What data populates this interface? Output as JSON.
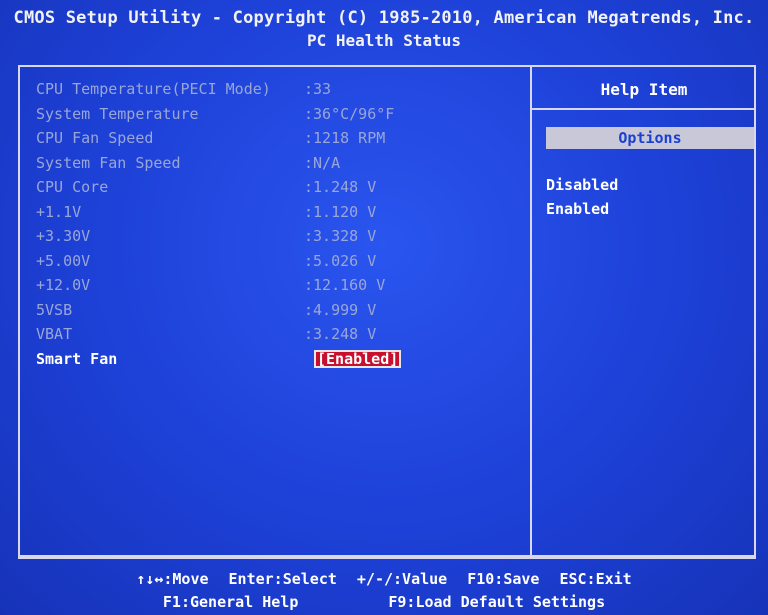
{
  "header": {
    "title": "CMOS Setup Utility - Copyright (C) 1985-2010, American Megatrends, Inc.",
    "subtitle": "PC Health Status"
  },
  "rows": [
    {
      "label": "CPU Temperature(PECI Mode)",
      "value": ":33"
    },
    {
      "label": "System Temperature",
      "value": ":36°C/96°F"
    },
    {
      "label": "CPU Fan Speed",
      "value": ":1218 RPM"
    },
    {
      "label": "System Fan Speed",
      "value": ":N/A"
    },
    {
      "label": "CPU Core",
      "value": ":1.248 V"
    },
    {
      "label": "+1.1V",
      "value": ":1.120 V"
    },
    {
      "label": "+3.30V",
      "value": ":3.328 V"
    },
    {
      "label": "+5.00V",
      "value": ":5.026 V"
    },
    {
      "label": "+12.0V",
      "value": ":12.160 V"
    },
    {
      "label": "5VSB",
      "value": ":4.999 V"
    },
    {
      "label": "VBAT",
      "value": ":3.248 V"
    },
    {
      "label": "Smart Fan",
      "value": "[Enabled]"
    }
  ],
  "help": {
    "title": "Help Item",
    "options_label": "Options",
    "options": [
      "Disabled",
      "Enabled"
    ]
  },
  "footer": {
    "line1": [
      "↑↓↔:Move",
      "Enter:Select",
      "+/-/:Value",
      "F10:Save",
      "ESC:Exit"
    ],
    "line2": [
      "F1:General Help",
      "F9:Load Default Settings"
    ]
  },
  "colors": {
    "background": "#1a3fd4",
    "selection": "#c8102e",
    "dim_text": "#9aa6d8",
    "bright_text": "#ffffff"
  }
}
